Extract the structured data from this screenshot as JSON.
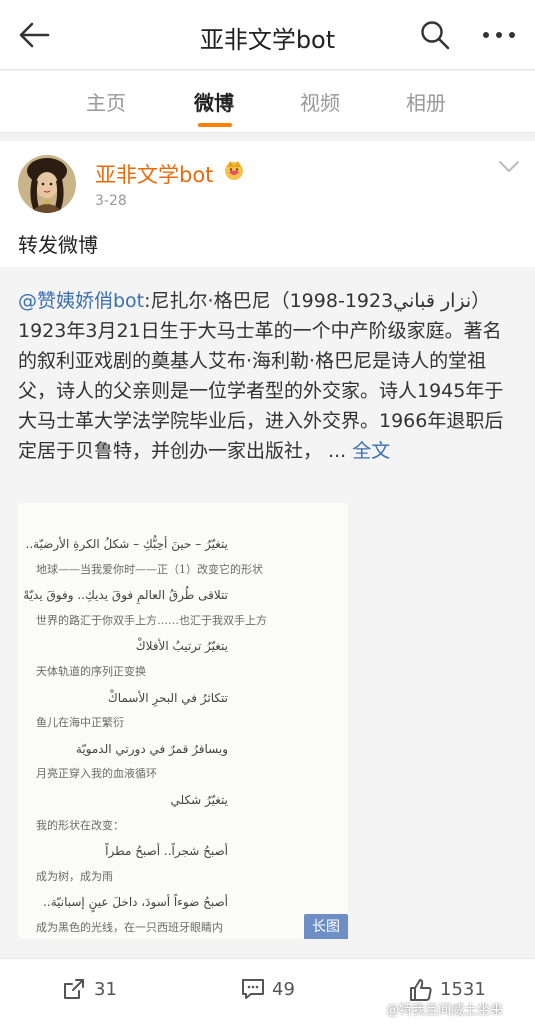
{
  "header": {
    "title": "亚非文学bot"
  },
  "tabs": [
    {
      "label": "主页"
    },
    {
      "label": "微博"
    },
    {
      "label": "视频"
    },
    {
      "label": "相册"
    }
  ],
  "post": {
    "author": "亚非文学bot",
    "date": "3-28",
    "text": "转发微博"
  },
  "repost": {
    "mention": "@赞姨娇俏bot",
    "line1": ":尼扎尔·格巴尼（",
    "arabic_name": "نزار قباني",
    "body": "1923-1998）1923年3月21日生于大马士革的一个中产阶级家庭。著名的叙利亚戏剧的奠基人艾布·海利勒·格巴尼是诗人的堂祖父，诗人的父亲则是一位学者型的外交家。诗人1945年于大马士革大学法学院毕业后，进入外交界。1966年退职后定居于贝鲁特，并创办一家出版社，",
    "ellipsis": " ... ",
    "full_text_link": "全文"
  },
  "poem_image": {
    "lines": [
      {
        "lang": "ar",
        "text": "يتغيّرُ – حينَ أحِبُّكِ – شكلُ الكرةِ الأرضيّة.."
      },
      {
        "lang": "zh",
        "text": "地球——当我爱你时——正（1）改变它的形状"
      },
      {
        "lang": "ar",
        "text": "تتلاقى طُرقُ العالمِ فوقَ يديكِ.. وفوقَ يديّهْ"
      },
      {
        "lang": "zh",
        "text": "世界的路汇于你双手上方……也汇于我双手上方"
      },
      {
        "lang": "ar",
        "text": "يتغيّرُ ترتيبُ الأفلاكْ"
      },
      {
        "lang": "zh",
        "text": "天体轨道的序列正变换"
      },
      {
        "lang": "ar",
        "text": "تتكاثرُ في البحرِ الأسماكْ"
      },
      {
        "lang": "zh",
        "text": "鱼儿在海中正繁衍"
      },
      {
        "lang": "ar",
        "text": "ويسافرُ قمرٌ في دورتي الدمويّة"
      },
      {
        "lang": "zh",
        "text": "月亮正穿入我的血液循环"
      },
      {
        "lang": "ar",
        "text": "يتغيّرُ شكلي"
      },
      {
        "lang": "zh",
        "text": "我的形状在改变："
      },
      {
        "lang": "ar",
        "text": "أصبحُ شجراً.. أصبحُ مطراً"
      },
      {
        "lang": "zh",
        "text": "成为树，成为雨"
      },
      {
        "lang": "ar",
        "text": "أصبحُ ضوءاً أسودَ، داخلَ عينٍ إسبانيّة.."
      },
      {
        "lang": "zh",
        "text": "成为黑色的光线，在一只西班牙眼睛内"
      }
    ],
    "badge": "长图"
  },
  "actions": {
    "reposts": "31",
    "comments": "49",
    "likes": "1531"
  },
  "watermark": "@特我旦间威土坐来",
  "colors": {
    "accent": "#ff8200",
    "author": "#e86b0c",
    "link": "#3a6fb0"
  }
}
